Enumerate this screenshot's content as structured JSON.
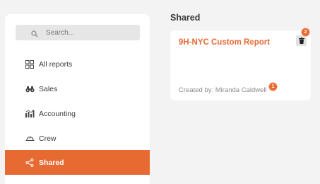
{
  "search": {
    "placeholder": "Search..."
  },
  "sidebar": {
    "items": [
      {
        "label": "All reports",
        "icon": "grid-icon"
      },
      {
        "label": "Sales",
        "icon": "binoculars-icon"
      },
      {
        "label": "Accounting",
        "icon": "bar-chart-icon"
      },
      {
        "label": "Crew",
        "icon": "hard-hat-icon"
      },
      {
        "label": "Shared",
        "icon": "share-icon",
        "active": true
      }
    ]
  },
  "main": {
    "section_title": "Shared",
    "card": {
      "title": "9H-NYC Custom Report",
      "created_by": "Created by: Miranda Caldwell",
      "trash_badge": "2",
      "creator_badge": "1"
    }
  },
  "colors": {
    "accent": "#e86a33",
    "background": "#f3f3f3"
  }
}
